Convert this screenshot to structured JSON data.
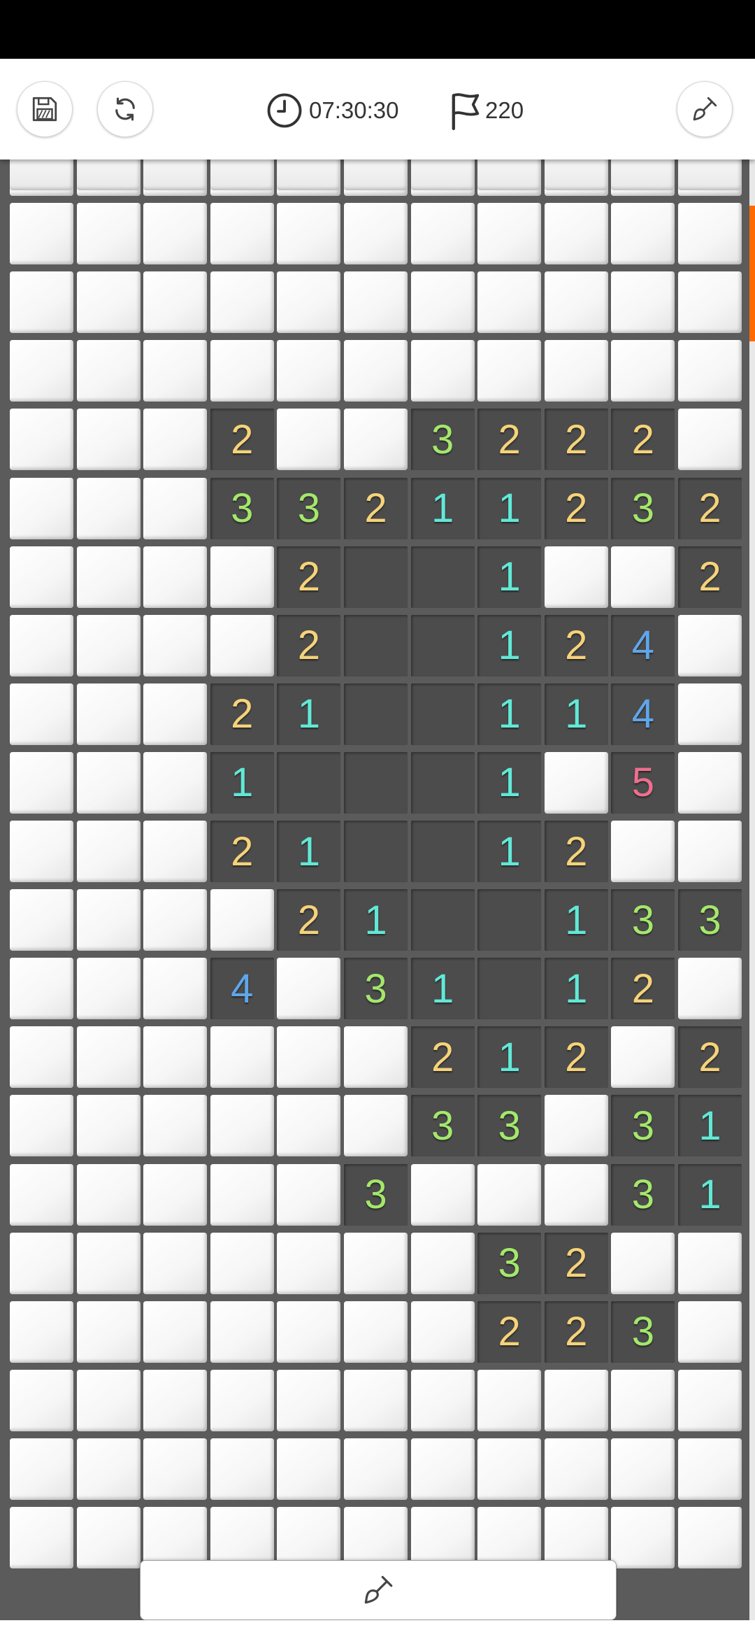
{
  "toolbar": {
    "timer": "07:30:30",
    "flags": "220",
    "icons": {
      "save": "save-icon",
      "restart": "refresh-icon",
      "timer": "clock-icon",
      "flags": "flag-icon",
      "mode": "shovel-icon"
    }
  },
  "board": {
    "columns": 11,
    "rows": [
      "HHHHHHHHHHH",
      "HHHHHHHHHHH",
      "HHHHHHHHHHH",
      "HHHHHHHHHHH",
      "HHH2HH3222H",
      "HHH33211232",
      "HHHH2..1HH2",
      "HHHH2..124H",
      "HHH21..114H",
      "HHH1...1H5H",
      "HHH21..12HH",
      "HHHH21..133",
      "HHH4H31.12H",
      "HHHHHH212H2",
      "HHHHHH33H31",
      "HHHHH3HHH31",
      "HHHHHHH32HH",
      "HHHHHHH223H",
      "HHHHHHHHHHH",
      "HHHHHHHHHHH",
      "HHHHHHHHHHH"
    ],
    "number_colors": {
      "1": "#62e8d6",
      "2": "#f6d37a",
      "3": "#a4e86c",
      "4": "#5fa6ea",
      "5": "#ee6f8e"
    }
  },
  "colors": {
    "scroll_accent": "#ff6a00",
    "revealed_cell": "#4c4c4c",
    "grid_background": "#5b5b5b"
  }
}
